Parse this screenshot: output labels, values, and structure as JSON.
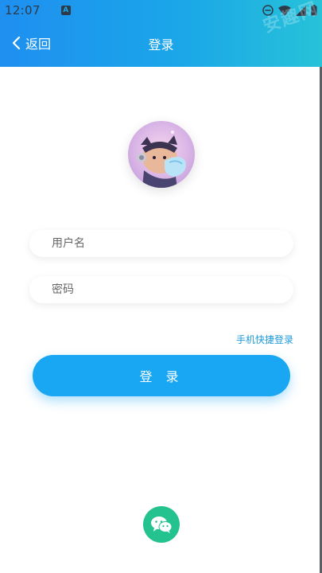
{
  "status_bar": {
    "time": "12:07",
    "badge_letter": "A",
    "icons": [
      "do-not-disturb-icon",
      "wifi-icon",
      "signal-icon",
      "battery-icon"
    ]
  },
  "nav": {
    "back_label": "返回",
    "title": "登录"
  },
  "form": {
    "username_placeholder": "用户名",
    "password_placeholder": "密码",
    "quick_login_label": "手机快捷登录",
    "login_button_label": "登 录"
  },
  "social": {
    "wechat_icon": "wechat-icon"
  },
  "watermark": {
    "text": "安趣网"
  },
  "colors": {
    "header_start": "#1f8ff0",
    "header_end": "#27c2d8",
    "primary": "#19a6f3",
    "link": "#1f9ad9",
    "wechat": "#24c28e"
  }
}
